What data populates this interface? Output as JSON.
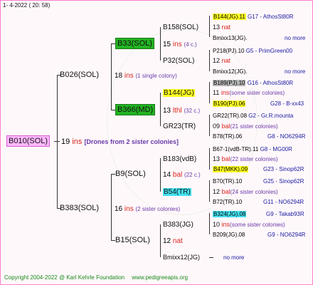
{
  "header": {
    "date": "1-  4-2022 ( 20: 58)"
  },
  "footer": {
    "copyright": "Copyright 2004-2022 @ Karl Kehrle Foundation",
    "url": "www.pedigreeapis.org"
  },
  "root": {
    "name": "B010(SOL)",
    "year": "19",
    "ins": "ins",
    "note": "[Drones from 2 sister colonies]"
  },
  "gen1": {
    "top": {
      "name": "B026(SOL)",
      "year": "18",
      "ins": "ins",
      "note": "(1 single colony)"
    },
    "bottom": {
      "name": "B383(SOL)",
      "year": "16",
      "ins": "ins",
      "note": "(2 sister colonies)"
    }
  },
  "gen2": [
    {
      "name": "B33(SOL)",
      "year": "15",
      "ins": "ins",
      "note": "(4 c.)"
    },
    {
      "name": "B366(MD)",
      "year": "13",
      "ins": "lthl",
      "note": "(32 c.)"
    },
    {
      "name": "B9(SOL)",
      "year": "14",
      "ins": "bal",
      "note": "(22 c.)"
    },
    {
      "name": "B15(SOL)",
      "year": "12",
      "ins": "nat",
      "note": ""
    }
  ],
  "gen3": [
    {
      "name": "B158(SOL)",
      "year": "13",
      "ins": "nat",
      "note": ""
    },
    {
      "name": "P32(SOL)",
      "year": "12",
      "ins": "nat",
      "note": ""
    },
    {
      "name": "B144(JG)",
      "year": "11",
      "ins": "ins",
      "note": "(some sister colonies)"
    },
    {
      "name": "GR23(TR)",
      "year": "09",
      "ins": "bal",
      "note": "(21 sister colonies)"
    },
    {
      "name": "B183(vdB)",
      "year": "13",
      "ins": "bal",
      "note": "(22 sister colonies)"
    },
    {
      "name": "B54(TR)",
      "year": "12",
      "ins": "bal",
      "note": "(24 sister colonies)"
    },
    {
      "name": "B383(JG)",
      "year": "10",
      "ins": "ins",
      "note": "(some sister colonies)"
    },
    {
      "name": "Bmixx12(JG)",
      "year": "",
      "ins": "",
      "note": "no more"
    }
  ],
  "gen4": [
    {
      "name": "B144(JG).11",
      "ref": "G17 - AthosSt80R"
    },
    {
      "name": "Bmixx13(JG).",
      "ref": "no more"
    },
    {
      "name": "P218(PJ).10",
      "ref": "G5 - PrimGreen00"
    },
    {
      "name": "Bmixx12(JG).",
      "ref": "no more"
    },
    {
      "name": "B189(PJ).10",
      "ref": "G16 - AthosSt80R"
    },
    {
      "name": "B190(PJ).06",
      "ref": "G28 - B-xx43"
    },
    {
      "name": "GR22(TR).08",
      "ref": "G2 - Gr.R.mounta"
    },
    {
      "name": "B78(TR).06",
      "ref": "G8 - NO6294R"
    },
    {
      "name": "B67-1(vdB-TR).11",
      "ref": "G8 - MG00R"
    },
    {
      "name": "B47(MKK).09",
      "ref": "G23 - Sinop62R"
    },
    {
      "name": "B70(TR).10",
      "ref": "G25 - Sinop62R"
    },
    {
      "name": "B72(TR).10",
      "ref": "G11 - NO6294R"
    },
    {
      "name": "B324(JG).08",
      "ref": "G9 - Takab93R"
    },
    {
      "name": "B209(JG).08",
      "ref": "G9 - NO6294R"
    }
  ],
  "colors": {
    "accent": "#22b422",
    "highlight": "#ffff22",
    "cyan": "#44e0ee",
    "root": "#ffb8ff",
    "border": "#ff7fd0"
  }
}
